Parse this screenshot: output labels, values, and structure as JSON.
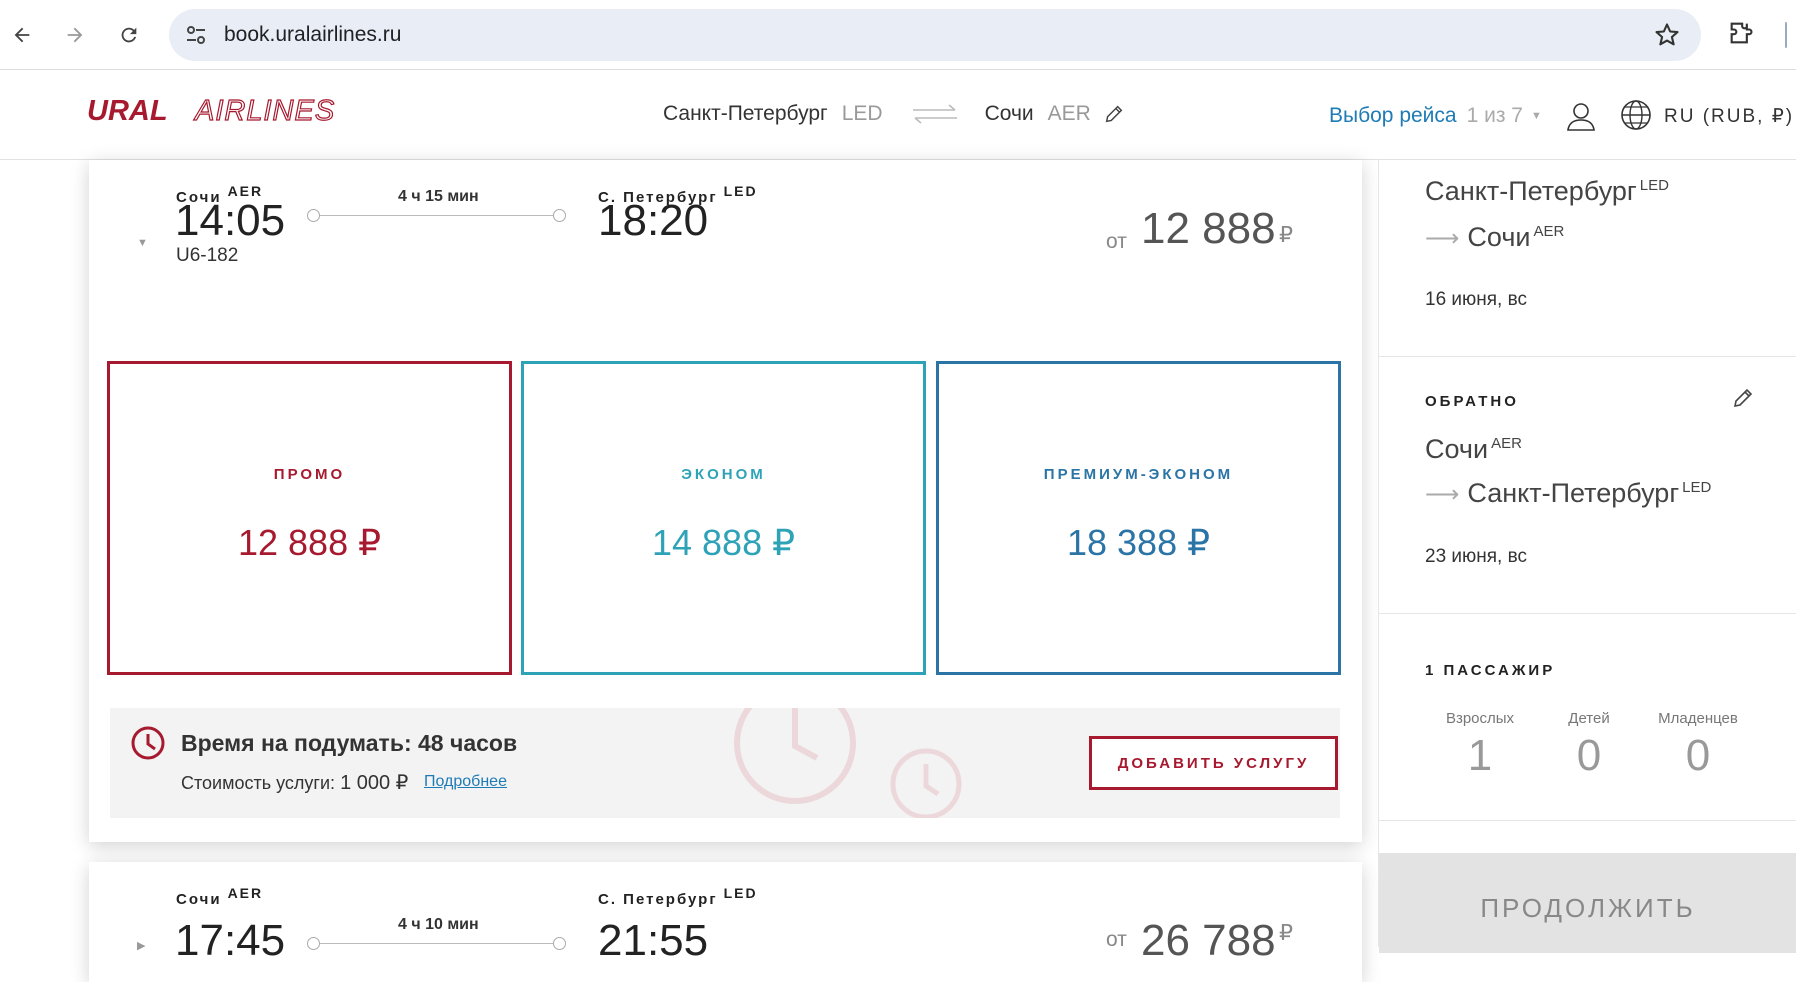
{
  "browser": {
    "url": "book.uralairlines.ru"
  },
  "header": {
    "logo_bold": "URAL",
    "logo_light": "AIRLINES",
    "origin_city": "Санкт-Петербург",
    "origin_code": "LED",
    "dest_city": "Сочи",
    "dest_code": "AER",
    "flight_select_label": "Выбор рейса",
    "flight_select_count": "1 из 7",
    "language": "RU (RUB, ₽)"
  },
  "flight": {
    "from_city": "Сочи",
    "from_code": "AER",
    "dep_time": "14:05",
    "flight_number": "U6-182",
    "duration": "4 ч 15 мин",
    "to_city": "С. Петербург",
    "to_code": "LED",
    "arr_time": "18:20",
    "price_from_label": "от",
    "price": "12 888",
    "currency": "₽"
  },
  "fares": [
    {
      "name": "ПРОМО",
      "price": "12 888 ₽",
      "color": "#a6192e"
    },
    {
      "name": "ЭКОНОМ",
      "price": "14 888 ₽",
      "color": "#2ea3b8"
    },
    {
      "name": "ПРЕМИУМ-ЭКОНОМ",
      "price": "18 388 ₽",
      "color": "#2a74a6"
    }
  ],
  "think": {
    "title": "Время на подумать: 48 часов",
    "cost_label": "Стоимость услуги:",
    "cost_value": "1 000 ₽",
    "more_link": "Подробнее",
    "add_button": "ДОБАВИТЬ УСЛУГУ"
  },
  "flight2": {
    "from_city": "Сочи",
    "from_code": "AER",
    "dep_time": "17:45",
    "duration": "4 ч 10 мин",
    "to_city": "С. Петербург",
    "to_code": "LED",
    "arr_time": "21:55",
    "price_from_label": "от",
    "price": "26 788",
    "currency": "₽"
  },
  "sidebar": {
    "outbound": {
      "from_city": "Санкт-Петербург",
      "from_code": "LED",
      "to_city": "Сочи",
      "to_code": "AER",
      "date": "16 июня, вс"
    },
    "return": {
      "label": "ОБРАТНО",
      "from_city": "Сочи",
      "from_code": "AER",
      "to_city": "Санкт-Петербург",
      "to_code": "LED",
      "date": "23 июня, вс"
    },
    "passengers": {
      "label": "1 ПАССАЖИР",
      "adults_label": "Взрослых",
      "adults": "1",
      "children_label": "Детей",
      "children": "0",
      "infants_label": "Младенцев",
      "infants": "0"
    },
    "continue_button": "ПРОДОЛЖИТЬ"
  }
}
